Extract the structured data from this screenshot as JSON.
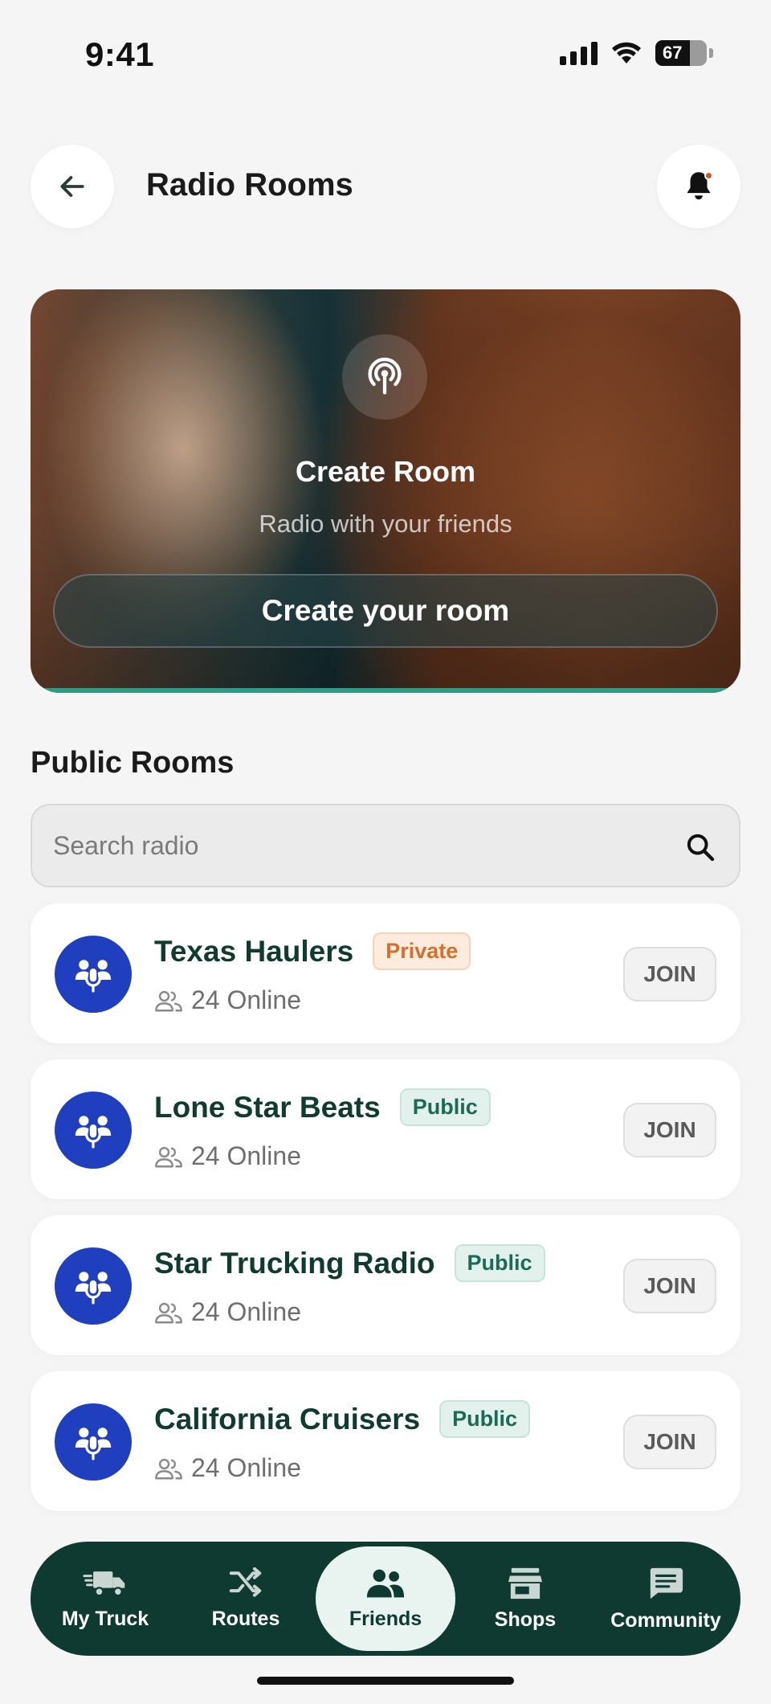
{
  "status_bar": {
    "time": "9:41",
    "battery": "67"
  },
  "header": {
    "title": "Radio Rooms"
  },
  "hero": {
    "title": "Create Room",
    "subtitle": "Radio with your friends",
    "button_label": "Create your room",
    "accent_color": "#2e9a84"
  },
  "public_rooms": {
    "title": "Public Rooms",
    "search_placeholder": "Search radio",
    "rooms": [
      {
        "name": "Texas Haulers",
        "badge": "Private",
        "online": "24 Online",
        "join_label": "JOIN"
      },
      {
        "name": "Lone Star Beats",
        "badge": "Public",
        "online": "24 Online",
        "join_label": "JOIN"
      },
      {
        "name": "Star Trucking Radio",
        "badge": "Public",
        "online": "24 Online",
        "join_label": "JOIN"
      },
      {
        "name": "California Cruisers",
        "badge": "Public",
        "online": "24 Online",
        "join_label": "JOIN"
      }
    ]
  },
  "bottom_nav": {
    "items": [
      {
        "label": "My Truck",
        "icon": "truck-icon"
      },
      {
        "label": "Routes",
        "icon": "shuffle-icon"
      },
      {
        "label": "Friends",
        "icon": "people-icon",
        "active": true
      },
      {
        "label": "Shops",
        "icon": "store-icon"
      },
      {
        "label": "Community",
        "icon": "chat-icon"
      }
    ]
  },
  "colors": {
    "background": "#f5f5f5",
    "nav_background": "#0f3a32",
    "room_avatar": "#1f3fbf",
    "private_badge": "#d2702c",
    "public_badge": "#1a6a55"
  }
}
